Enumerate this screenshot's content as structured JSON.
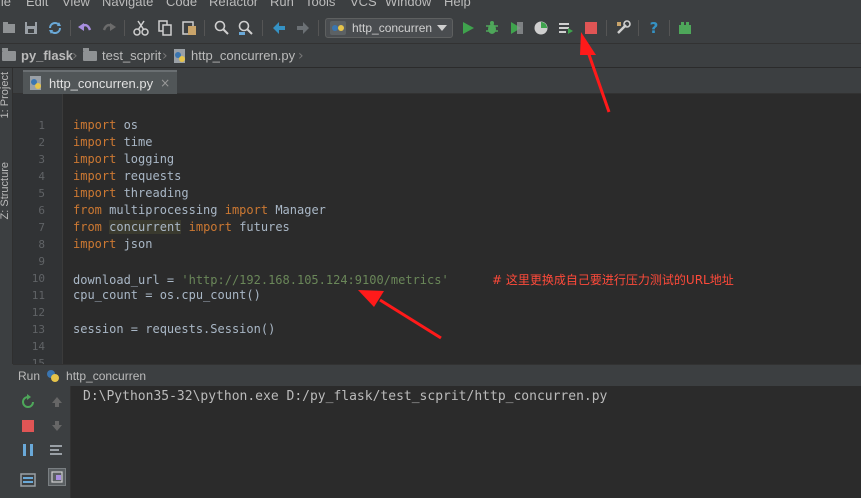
{
  "window": {
    "menu": [
      {
        "label": "ile"
      },
      {
        "label": "Edit"
      },
      {
        "label": "View"
      },
      {
        "label": "Navigate"
      },
      {
        "label": "Code"
      },
      {
        "label": "Refactor"
      },
      {
        "label": "Run"
      },
      {
        "label": "Tools"
      },
      {
        "label": "VCS"
      },
      {
        "label": "Window"
      },
      {
        "label": "Help"
      }
    ]
  },
  "toolbar": {
    "run_config": "http_concurren",
    "icons": [
      "open-icon",
      "save-icon",
      "sync-icon",
      "undo-icon",
      "redo-icon",
      "cut-icon",
      "copy-icon",
      "paste-icon",
      "find-icon",
      "replace-icon",
      "back-icon",
      "forward-icon",
      "run-icon",
      "debug-icon",
      "coverage-icon",
      "profile-icon",
      "concurrency-icon",
      "stop-icon",
      "settings-icon",
      "help-icon",
      "plugin-icon"
    ],
    "colors": {
      "run": "#3fa34d",
      "stop": "#e05555",
      "accent": "#3592c4"
    }
  },
  "breadcrumb": {
    "items": [
      "py_flask",
      "test_scprit",
      "http_concurren.py"
    ]
  },
  "side_tabs": {
    "project": "1: Project",
    "structure": "Z: Structure"
  },
  "editor": {
    "tab_label": "http_concurren.py",
    "tab_close": "×",
    "lines": [
      {
        "n": "1",
        "parts": [
          {
            "t": "import",
            "c": "kw"
          },
          {
            "t": " os",
            "c": "fn"
          }
        ]
      },
      {
        "n": "2",
        "parts": [
          {
            "t": "import",
            "c": "kw"
          },
          {
            "t": " time",
            "c": "fn"
          }
        ]
      },
      {
        "n": "3",
        "parts": [
          {
            "t": "import",
            "c": "kw"
          },
          {
            "t": " logging",
            "c": "fn"
          }
        ]
      },
      {
        "n": "4",
        "parts": [
          {
            "t": "import",
            "c": "kw"
          },
          {
            "t": " requests",
            "c": "fn"
          }
        ]
      },
      {
        "n": "5",
        "parts": [
          {
            "t": "import",
            "c": "kw"
          },
          {
            "t": " threading",
            "c": "fn"
          }
        ]
      },
      {
        "n": "6",
        "parts": [
          {
            "t": "from",
            "c": "kw"
          },
          {
            "t": " multiprocessing ",
            "c": "fn"
          },
          {
            "t": "import",
            "c": "kw"
          },
          {
            "t": " Manager",
            "c": "fn"
          }
        ]
      },
      {
        "n": "7",
        "parts": [
          {
            "t": "from",
            "c": "kw"
          },
          {
            "t": " ",
            "c": "fn"
          },
          {
            "t": "concurrent",
            "c": "hl"
          },
          {
            "t": " ",
            "c": "fn"
          },
          {
            "t": "import",
            "c": "kw"
          },
          {
            "t": " futures",
            "c": "fn"
          }
        ]
      },
      {
        "n": "8",
        "parts": [
          {
            "t": "import",
            "c": "kw"
          },
          {
            "t": " json",
            "c": "fn"
          }
        ]
      },
      {
        "n": "9",
        "parts": []
      },
      {
        "n": "10",
        "parts": [
          {
            "t": "download_url = ",
            "c": "fn"
          },
          {
            "t": "'http://192.168.105.124:9100/metrics'",
            "c": "str"
          },
          {
            "t": "      ",
            "c": "fn"
          },
          {
            "t": "# 这里更换成自己要进行压力测试的URL地址",
            "c": "cm"
          }
        ]
      },
      {
        "n": "11",
        "parts": [
          {
            "t": "cpu_count = os.cpu_count()",
            "c": "fn"
          }
        ]
      },
      {
        "n": "12",
        "parts": []
      },
      {
        "n": "13",
        "parts": [
          {
            "t": "session = requests.Session()",
            "c": "fn"
          }
        ]
      },
      {
        "n": "14",
        "parts": []
      },
      {
        "n": "15",
        "parts": []
      }
    ]
  },
  "run_panel": {
    "label": "Run",
    "config_name": "http_concurren",
    "command": "D:\\Python35-32\\python.exe D:/py_flask/test_scprit/http_concurren.py"
  }
}
